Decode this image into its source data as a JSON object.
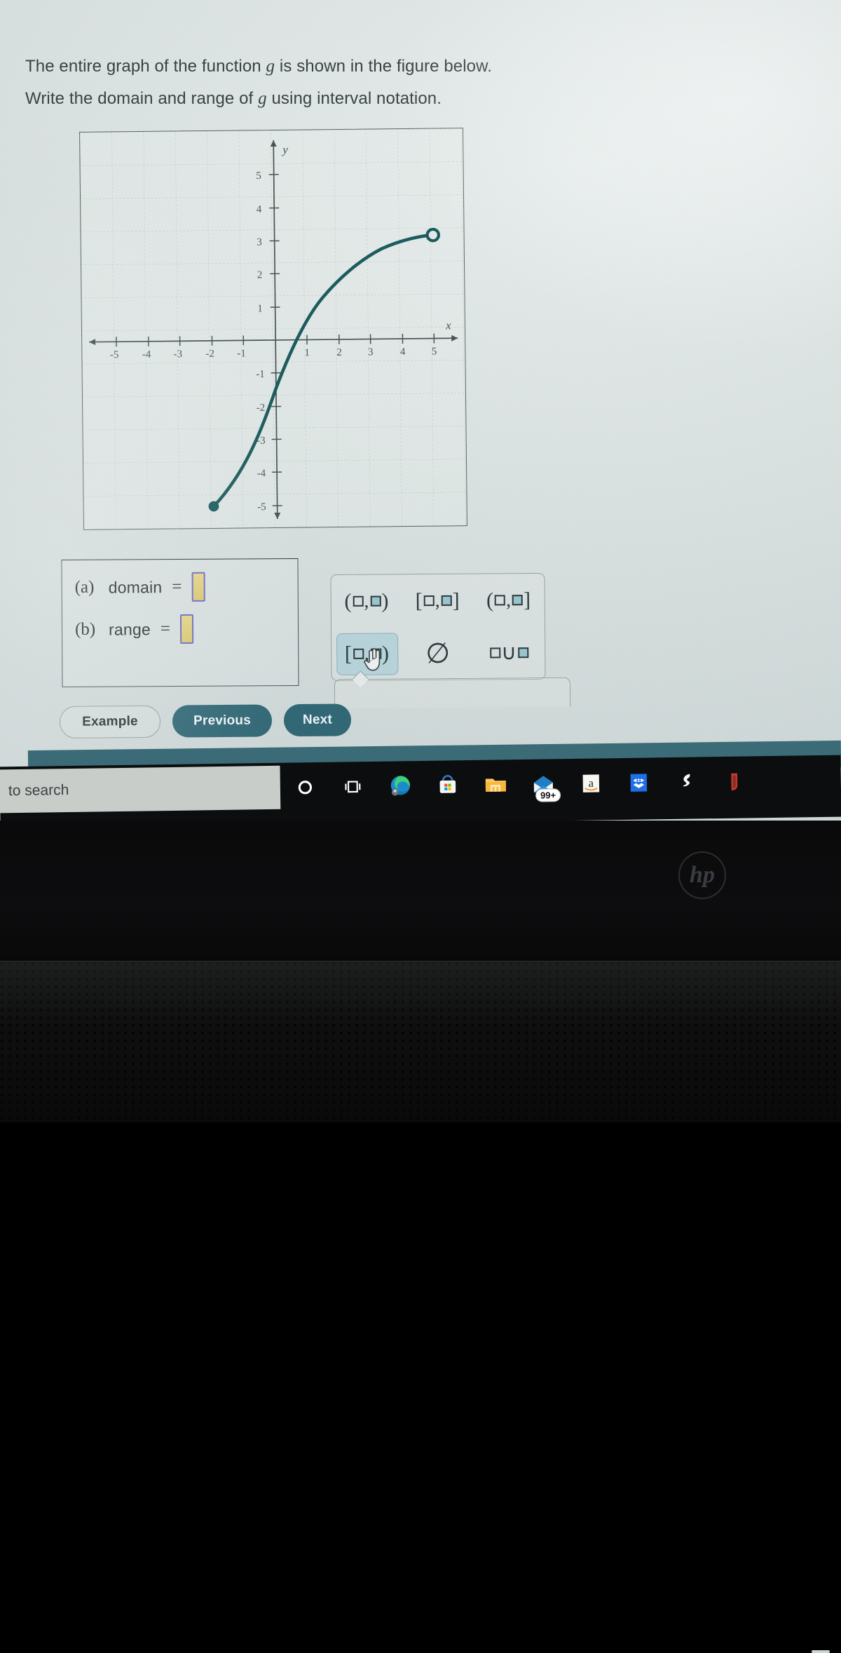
{
  "question": {
    "line1_a": "The entire graph of the function ",
    "line1_var": "g",
    "line1_b": " is shown in the figure below.",
    "line2_a": "Write the domain and range of ",
    "line2_var": "g",
    "line2_b": " using interval notation."
  },
  "chart_data": {
    "type": "line",
    "title": "",
    "xlabel": "x",
    "ylabel": "y",
    "xlim": [
      -5.8,
      5.8
    ],
    "ylim": [
      -5.8,
      5.8
    ],
    "grid": true,
    "x_ticks": [
      -5,
      -4,
      -3,
      -2,
      -1,
      1,
      2,
      3,
      4,
      5
    ],
    "y_ticks": [
      5,
      4,
      3,
      2,
      1,
      -1,
      -2,
      -3,
      -4,
      -5
    ],
    "x_tick_labels": [
      "-5",
      "-4",
      "-3",
      "-2",
      "-1",
      "1",
      "2",
      "3",
      "4",
      "5"
    ],
    "y_tick_labels": [
      "5",
      "4",
      "3",
      "2",
      "1",
      "-1",
      "-2",
      "-3",
      "-4",
      "-5"
    ],
    "series": [
      {
        "name": "g",
        "color": "#1d5d60",
        "points": [
          [
            -2,
            -5
          ],
          [
            -1.5,
            -4.1
          ],
          [
            -1,
            -3.2
          ],
          [
            -0.5,
            -2.3
          ],
          [
            0,
            -1.45
          ],
          [
            0.5,
            -0.7
          ],
          [
            1,
            0.05
          ],
          [
            1.5,
            0.72
          ],
          [
            2,
            1.3
          ],
          [
            2.5,
            1.8
          ],
          [
            3,
            2.22
          ],
          [
            3.5,
            2.55
          ],
          [
            4,
            2.78
          ],
          [
            4.5,
            2.93
          ],
          [
            5,
            3
          ]
        ],
        "start_endpoint": {
          "x": -2,
          "y": -5,
          "style": "closed"
        },
        "end_endpoint": {
          "x": 5,
          "y": 3,
          "style": "open"
        }
      }
    ],
    "domain_shown": "[-2, 5)",
    "range_shown": "[-5, 3)"
  },
  "answers": {
    "a_tag": "(a)",
    "a_label": "domain",
    "a_equals": "=",
    "a_value": "",
    "b_tag": "(b)",
    "b_label": "range",
    "b_equals": "=",
    "b_value": "",
    "box_fill": "#ddcb72",
    "box_border": "#6e6fc0"
  },
  "palette": {
    "buttons": [
      {
        "id": "open-open",
        "label": "(□,□)",
        "active": false
      },
      {
        "id": "closed-closed",
        "label": "[□,□]",
        "active": false
      },
      {
        "id": "open-closed",
        "label": "(□,□]",
        "active": false
      },
      {
        "id": "closed-open",
        "label": "[□,□)",
        "active": true
      },
      {
        "id": "empty-set",
        "label": "∅",
        "active": false
      },
      {
        "id": "union",
        "label": "□∪□",
        "active": false
      }
    ],
    "active_color": "#bcd7de"
  },
  "nav": {
    "example": "Example",
    "previous": "Previous",
    "next": "Next"
  },
  "taskbar": {
    "search_text": "to search",
    "icons": [
      {
        "name": "cortana-icon",
        "glyph": "○"
      },
      {
        "name": "task-view-icon",
        "glyph": "⧉"
      },
      {
        "name": "edge-browser-icon",
        "glyph": ""
      },
      {
        "name": "microsoft-store-icon",
        "glyph": ""
      },
      {
        "name": "file-explorer-icon",
        "glyph": ""
      },
      {
        "name": "mail-icon",
        "glyph": "",
        "badge": "99+"
      },
      {
        "name": "amazon-icon",
        "glyph": "a"
      },
      {
        "name": "dropbox-icon",
        "glyph": ""
      },
      {
        "name": "lightning-s-icon",
        "glyph": ""
      },
      {
        "name": "adobe-acrobat-icon",
        "glyph": ""
      }
    ],
    "mail_badge": "99+"
  },
  "device": {
    "brand": "hp"
  },
  "colors": {
    "curve": "#1d5d60",
    "button_solid": "#336a78",
    "taskbar_strip": "#3a6b77",
    "screen_bg": "#e4eae9"
  }
}
